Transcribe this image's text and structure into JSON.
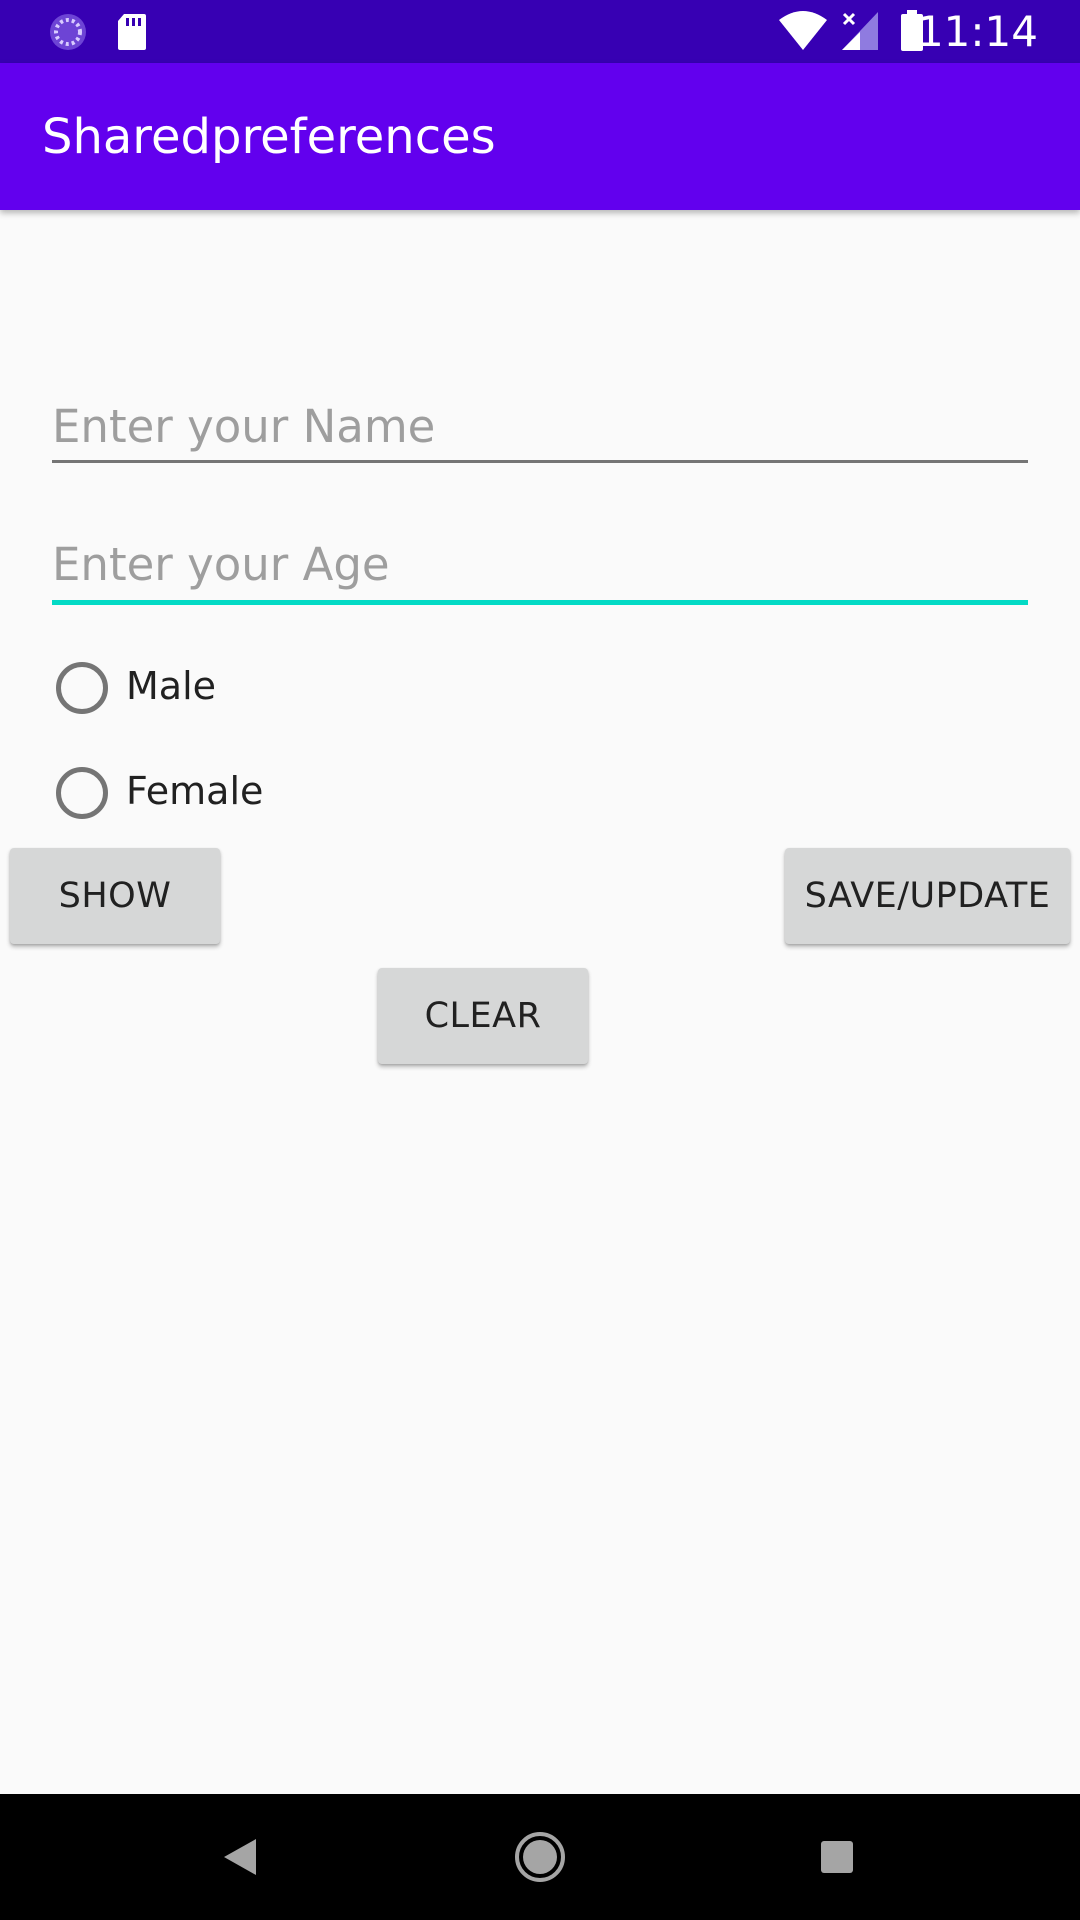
{
  "status_bar": {
    "time": "11:14",
    "left_icons": [
      "loading-circle-icon",
      "sd-card-icon"
    ],
    "right_icons": [
      "wifi-icon",
      "cellular-no-signal-icon",
      "battery-icon"
    ],
    "background": "#3700b3"
  },
  "app_bar": {
    "title": "Sharedpreferences",
    "background": "#6200ee"
  },
  "form": {
    "name_placeholder": "Enter your Name",
    "age_placeholder": "Enter your Age",
    "age_focused": true,
    "accent_color": "#03dac5",
    "gender_options": [
      {
        "label": "Male",
        "checked": false
      },
      {
        "label": "Female",
        "checked": false
      }
    ]
  },
  "buttons": {
    "show": "SHOW",
    "save_update": "SAVE/UPDATE",
    "clear": "CLEAR"
  },
  "nav_bar": {
    "icons": [
      "back-icon",
      "home-icon",
      "recents-icon"
    ]
  }
}
